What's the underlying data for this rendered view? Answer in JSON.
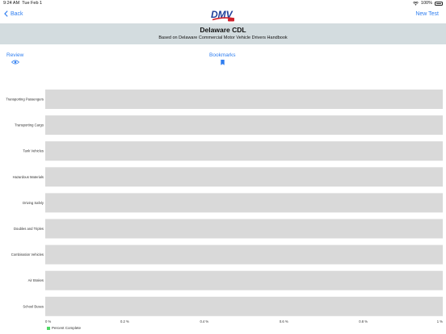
{
  "status_bar": {
    "time": "9:24 AM",
    "date": "Tue Feb 1",
    "battery": "100%"
  },
  "nav": {
    "back_label": "Back",
    "new_test_label": "New Test",
    "logo_text": "DMV"
  },
  "header": {
    "title": "Delaware CDL",
    "subtitle": "Based on Delaware Commercial Motor Vehicle Drivers Handbook"
  },
  "actions": {
    "review_label": "Review",
    "bookmarks_label": "Bookmarks"
  },
  "colors": {
    "accent": "#2f7ef0",
    "bar_track": "#d9d9d9",
    "bar_fill": "#4cd964",
    "band": "#d3dcdf"
  },
  "chart_data": {
    "type": "bar",
    "orientation": "horizontal",
    "categories": [
      "Transporting Passengers",
      "Transporting Cargo",
      "Tank Vehicles",
      "Hazardous Materials",
      "Driving Safely",
      "Doubles and Triples",
      "Combination Vehicles",
      "Air Brakes",
      "School Buses"
    ],
    "series": [
      {
        "name": "Percent Complete",
        "values": [
          0,
          0,
          0,
          0,
          0,
          0,
          0,
          0,
          0
        ]
      }
    ],
    "xlim": [
      0,
      1
    ],
    "x_ticks": [
      "0 %",
      "0.2 %",
      "0.4 %",
      "0.6 %",
      "0.8 %",
      "1 %"
    ],
    "legend": "bottom-left"
  }
}
